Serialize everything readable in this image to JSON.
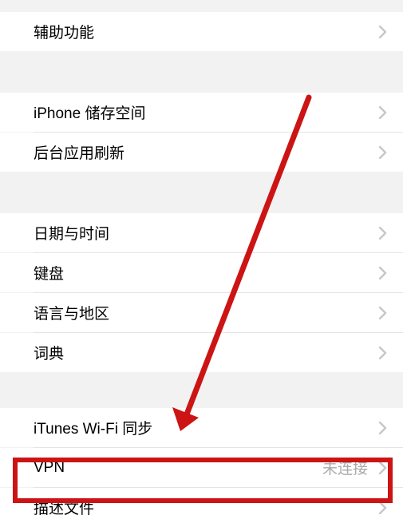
{
  "sections": {
    "s1": {
      "items": [
        {
          "label": "辅助功能"
        }
      ]
    },
    "s2": {
      "items": [
        {
          "label": "iPhone 储存空间"
        },
        {
          "label": "后台应用刷新"
        }
      ]
    },
    "s3": {
      "items": [
        {
          "label": "日期与时间"
        },
        {
          "label": "键盘"
        },
        {
          "label": "语言与地区"
        },
        {
          "label": "词典"
        }
      ]
    },
    "s4": {
      "items": [
        {
          "label": "iTunes Wi-Fi 同步"
        },
        {
          "label": "VPN",
          "detail": "未连接"
        },
        {
          "label": "描述文件"
        }
      ]
    }
  },
  "annotations": {
    "highlight_target": "描述文件",
    "highlight_color": "#cc1414"
  }
}
